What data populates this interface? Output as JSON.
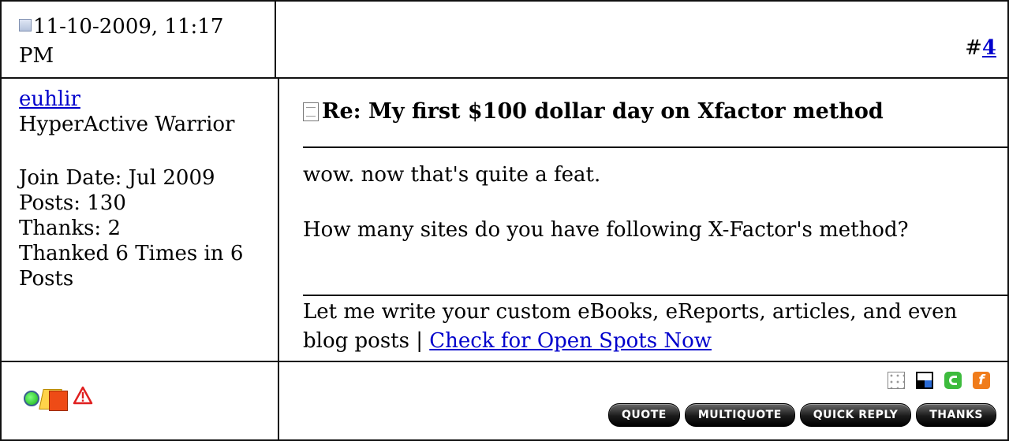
{
  "post_header": {
    "date": "11-10-2009, 11:17 PM",
    "post_number_prefix": "#",
    "post_number": "4"
  },
  "user": {
    "username": "euhlir",
    "title": "HyperActive Warrior",
    "join_date": "Join Date: Jul 2009",
    "posts": "Posts: 130",
    "thanks": "Thanks: 2",
    "thanked": "Thanked 6 Times in 6 Posts"
  },
  "post": {
    "title": "Re: My first $100 dollar day on Xfactor method",
    "lines": [
      "wow. now that's quite a feat.",
      "How many sites do you have following X-Factor's method?"
    ],
    "signature_text": "Let me write your custom eBooks, eReports, articles, and even blog posts | ",
    "signature_link": "Check for Open Spots Now"
  },
  "icons": {
    "status": [
      "online-icon",
      "reputation-icon",
      "report-post-icon"
    ],
    "social": [
      "social-network-icon",
      "delicious-icon",
      "technorati-icon",
      "facebook-icon"
    ]
  },
  "actions": {
    "quote": "QUOTE",
    "multiquote": "MULTIQUOTE",
    "quick_reply": "QUICK REPLY",
    "thanks": "THANKS"
  },
  "colors": {
    "link": "#0000cc",
    "border": "#111111",
    "button_bg": "#000000"
  }
}
